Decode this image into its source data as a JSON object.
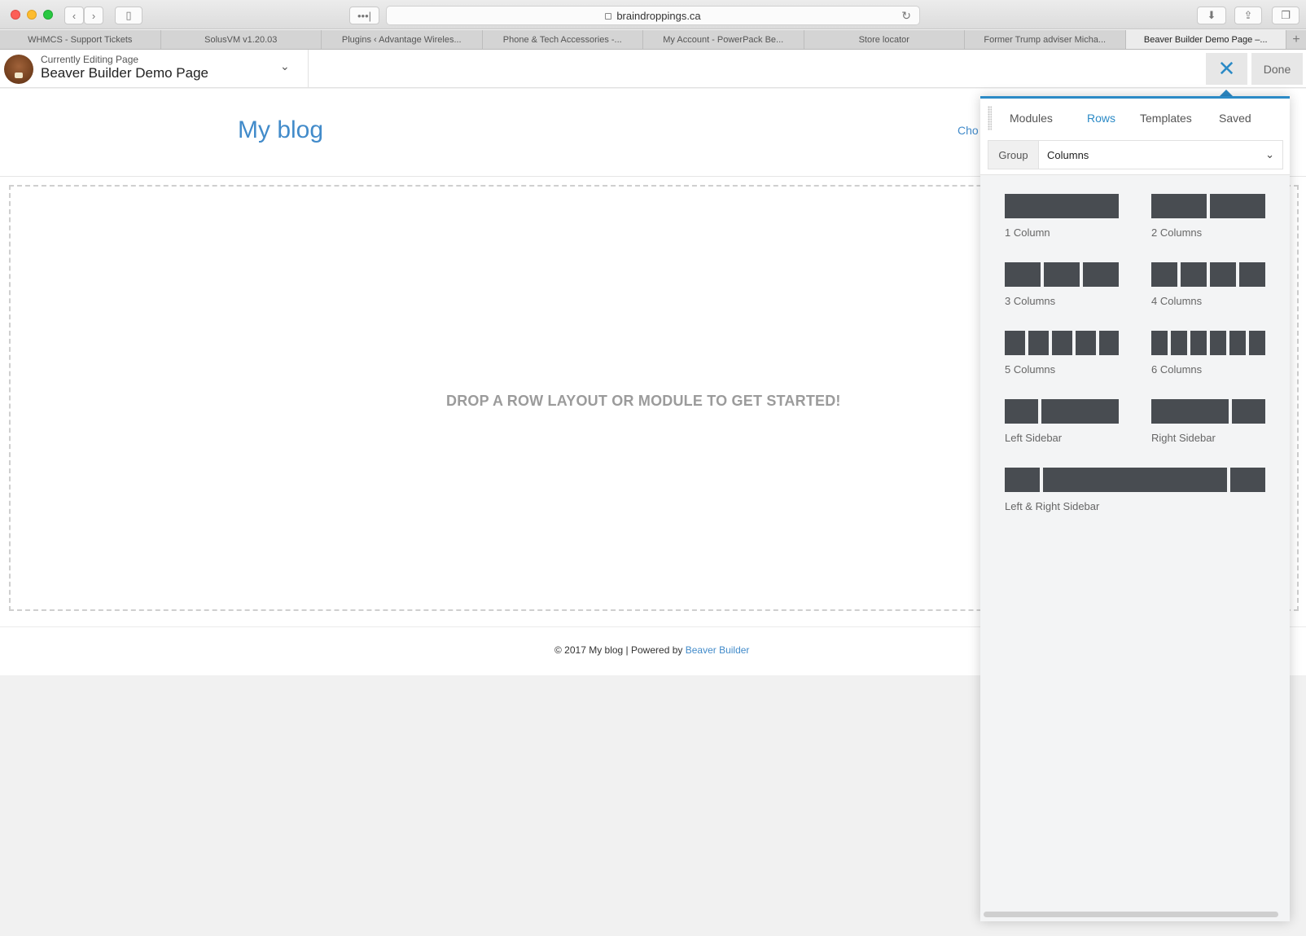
{
  "browser": {
    "url": "braindroppings.ca",
    "tabs": [
      {
        "label": "WHMCS - Support Tickets"
      },
      {
        "label": "SolusVM v1.20.03"
      },
      {
        "label": "Plugins ‹ Advantage Wireles..."
      },
      {
        "label": "Phone & Tech Accessories -..."
      },
      {
        "label": "My Account - PowerPack Be..."
      },
      {
        "label": "Store locator"
      },
      {
        "label": "Former Trump adviser Micha..."
      },
      {
        "label": "Beaver Builder Demo Page –..."
      }
    ],
    "reader_label": "•••|"
  },
  "builder_bar": {
    "editing_label": "Currently Editing Page",
    "page_title": "Beaver Builder Demo Page",
    "done_label": "Done"
  },
  "page": {
    "site_title": "My blog",
    "choose_link": "Cho",
    "drop_message": "DROP A ROW LAYOUT OR MODULE TO GET STARTED!",
    "footer": {
      "prefix": "© 2017 My blog | Powered by ",
      "link": "Beaver Builder"
    }
  },
  "panel": {
    "tabs": [
      {
        "label": "Modules",
        "active": false
      },
      {
        "label": "Rows",
        "active": true
      },
      {
        "label": "Templates",
        "active": false
      },
      {
        "label": "Saved",
        "active": false
      }
    ],
    "group_label": "Group",
    "group_value": "Columns",
    "layouts": [
      {
        "label": "1 Column"
      },
      {
        "label": "2 Columns"
      },
      {
        "label": "3 Columns"
      },
      {
        "label": "4 Columns"
      },
      {
        "label": "5 Columns"
      },
      {
        "label": "6 Columns"
      },
      {
        "label": "Left Sidebar"
      },
      {
        "label": "Right Sidebar"
      },
      {
        "label": "Left & Right Sidebar"
      }
    ]
  },
  "colors": {
    "accent": "#2b8ac6",
    "link": "#428bca",
    "block": "#484c51"
  }
}
